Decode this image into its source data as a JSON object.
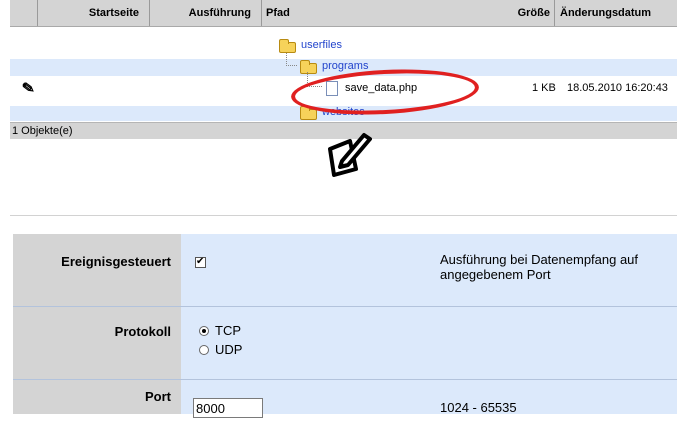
{
  "table": {
    "headers": {
      "startseite": "Startseite",
      "ausfuehrung": "Ausführung",
      "pfad": "Pfad",
      "groesse": "Größe",
      "aenderungsdatum": "Änderungsdatum"
    },
    "tree": {
      "root": "userfiles",
      "folder1": "programs",
      "file": "save_data.php",
      "folder2": "websites"
    },
    "file_size": "1 KB",
    "file_date": "18.05.2010 16:20:43",
    "status": "1 Objekte(e)"
  },
  "settings": {
    "ereignis_label": "Ereignisgesteuert",
    "ereignis_checked": true,
    "ereignis_desc_line1": "Ausführung bei Datenempfang auf",
    "ereignis_desc_line2": "angegebenem Port",
    "protokoll_label": "Protokoll",
    "protokoll_options": [
      "TCP",
      "UDP"
    ],
    "protokoll_selected": "TCP",
    "port_label": "Port",
    "port_value": "8000",
    "port_range": "1024 - 65535"
  },
  "icons": {
    "edit_small": "edit-icon",
    "edit_large": "edit-icon-large",
    "folder": "folder-icon",
    "file": "file-icon"
  },
  "colors": {
    "header_bg": "#d4d4d4",
    "row_blue": "#dce9fb",
    "link": "#2244cc",
    "highlight": "#e02020"
  }
}
